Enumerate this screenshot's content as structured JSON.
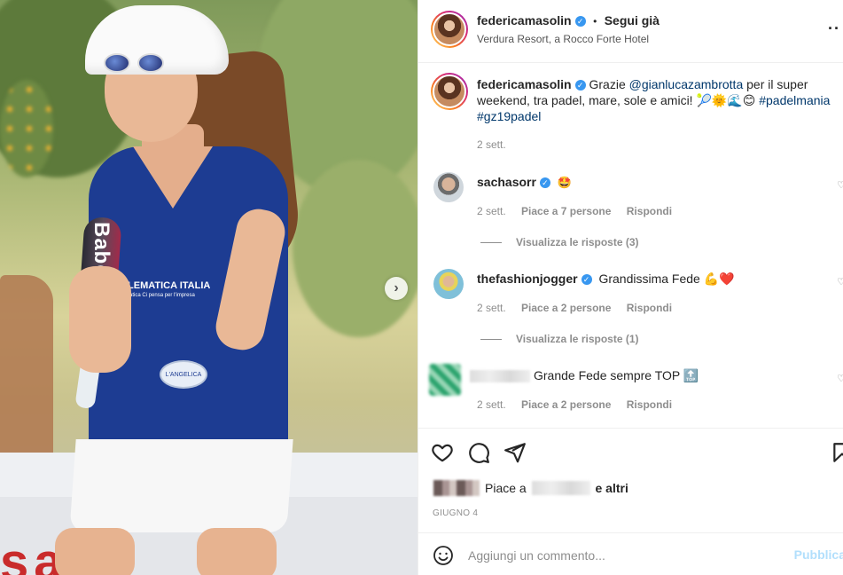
{
  "post": {
    "author": "federicamasolin",
    "follow_label": "Segui già",
    "separator": "•",
    "location": "Verdura Resort, a Rocco Forte Hotel",
    "more_icon": "more-dots-icon"
  },
  "photo": {
    "racket_text": "Babolat",
    "shirt_brand": "TELEMATICA ITALIA",
    "shirt_tagline": "Telematica Ci pensa per l'impresa",
    "badge_text": "L'ANGELICA",
    "court_text": "sar",
    "next_icon": "chevron-right-icon"
  },
  "caption": {
    "author": "federicamasolin",
    "text_start": "Grazie ",
    "mention": "@gianlucazambrotta",
    "text_mid": " per il super weekend, tra padel, mare, sole e amici! 🎾🌞🌊😊 ",
    "hashtag1": "#padelmania",
    "hashtag2": "#gz19padel",
    "time": "2 sett."
  },
  "comments": [
    {
      "user": "sachasorr",
      "text": "🤩",
      "time": "2 sett.",
      "likes": "Piace a 7 persone",
      "reply": "Rispondi",
      "view_replies": "Visualizza le risposte (3)"
    },
    {
      "user": "thefashionjogger",
      "text": "Grandissima Fede 💪❤️",
      "time": "2 sett.",
      "likes": "Piace a 2 persone",
      "reply": "Rispondi",
      "view_replies": "Visualizza le risposte (1)"
    },
    {
      "user": "",
      "text": "Grande Fede sempre TOP 🔝",
      "time": "2 sett.",
      "likes": "Piace a 2 persone",
      "reply": "Rispondi"
    }
  ],
  "actions": {
    "like_icon": "heart-icon",
    "comment_icon": "comment-icon",
    "share_icon": "send-icon",
    "save_icon": "bookmark-icon",
    "likes_prefix": "Piace a",
    "likes_suffix": "e altri",
    "date": "GIUGNO 4"
  },
  "composer": {
    "emoji_icon": "smiley-icon",
    "placeholder": "Aggiungi un commento...",
    "publish_label": "Pubblica"
  },
  "colors": {
    "link": "#00376b",
    "verified": "#3897f0",
    "muted": "#8e8e8e",
    "publish_disabled": "#b2dffc",
    "shirt": "#1d3c92"
  }
}
